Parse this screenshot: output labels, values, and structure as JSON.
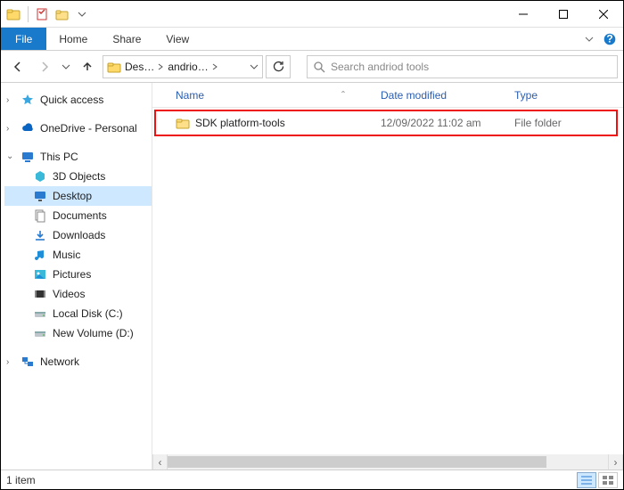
{
  "ribbon": {
    "file": "File",
    "home": "Home",
    "share": "Share",
    "view": "View"
  },
  "breadcrumb": {
    "seg1": "Des…",
    "seg2": "andrio…"
  },
  "search": {
    "placeholder": "Search andriod tools"
  },
  "nav": {
    "quick_access": "Quick access",
    "onedrive": "OneDrive - Personal",
    "this_pc": "This PC",
    "objects3d": "3D Objects",
    "desktop": "Desktop",
    "documents": "Documents",
    "downloads": "Downloads",
    "music": "Music",
    "pictures": "Pictures",
    "videos": "Videos",
    "local_disk": "Local Disk (C:)",
    "new_volume": "New Volume (D:)",
    "network": "Network"
  },
  "columns": {
    "name": "Name",
    "date": "Date modified",
    "type": "Type"
  },
  "rows": [
    {
      "name": "SDK platform-tools",
      "date": "12/09/2022 11:02 am",
      "type": "File folder"
    }
  ],
  "status": {
    "count": "1 item"
  }
}
